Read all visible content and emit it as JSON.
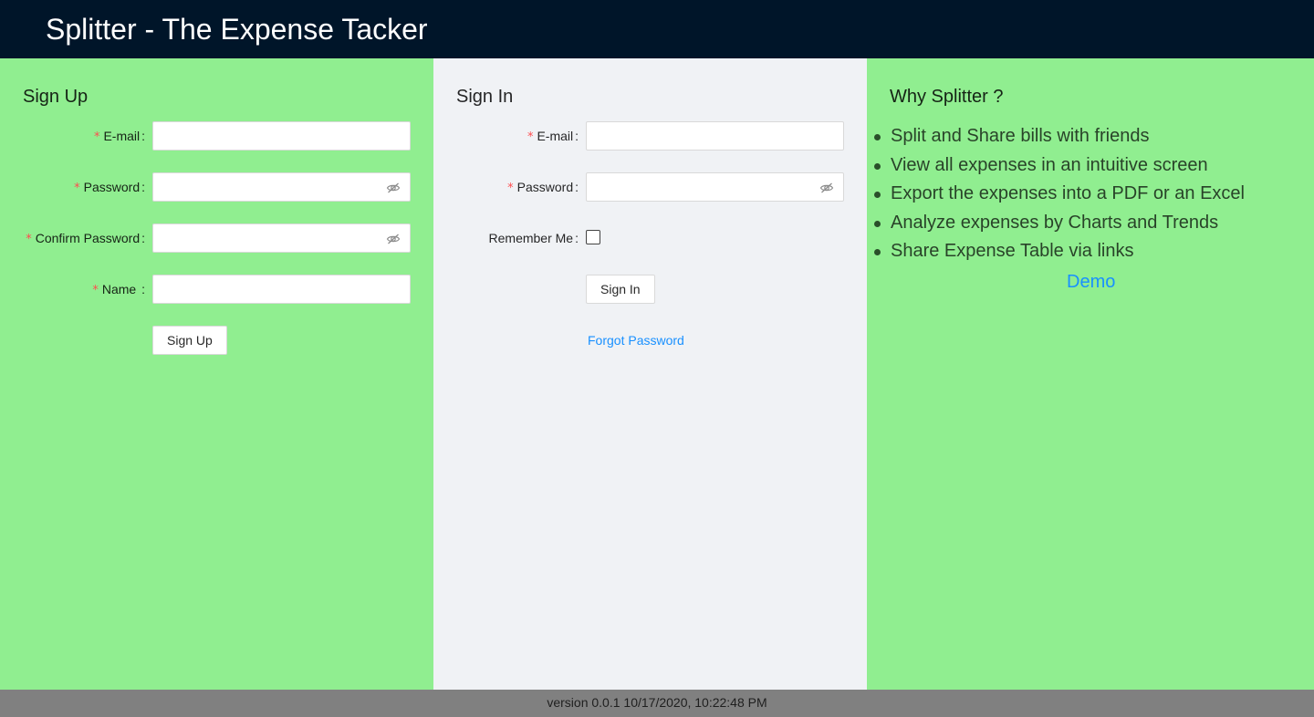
{
  "header": {
    "title": "Splitter - The Expense Tacker"
  },
  "signup": {
    "title": "Sign Up",
    "fields": [
      {
        "label": "E-mail",
        "value": "",
        "required": "*"
      },
      {
        "label": "Password",
        "value": "",
        "required": "*"
      },
      {
        "label": "Confirm Password",
        "value": "",
        "required": "*"
      },
      {
        "label": "Name",
        "value": "",
        "required": "*"
      }
    ],
    "submit_label": "Sign Up"
  },
  "signin": {
    "title": "Sign In",
    "fields": [
      {
        "label": "E-mail",
        "value": "",
        "required": "*"
      },
      {
        "label": "Password",
        "value": "",
        "required": "*"
      }
    ],
    "remember_label": "Remember Me",
    "remember_checked": false,
    "submit_label": "Sign In",
    "forgot_label": "Forgot Password"
  },
  "why": {
    "title": "Why Splitter ?",
    "points": [
      "Split and Share bills with friends",
      "View all expenses in an intuitive screen",
      "Export the expenses into a PDF or an Excel",
      "Analyze expenses by Charts and Trends",
      "Share Expense Table via links"
    ],
    "demo_label": "Demo"
  },
  "footer": {
    "version_text": "version 0.0.1 10/17/2020, 10:22:48 PM"
  },
  "colors": {
    "header_bg": "#001529",
    "panel_green": "#90ee90",
    "panel_gray": "#f0f2f5",
    "link_blue": "#1890ff",
    "required_red": "#ff4d4f",
    "footer_bg": "#808080"
  },
  "icons": {
    "password_toggle": "eye-invisible-icon"
  }
}
